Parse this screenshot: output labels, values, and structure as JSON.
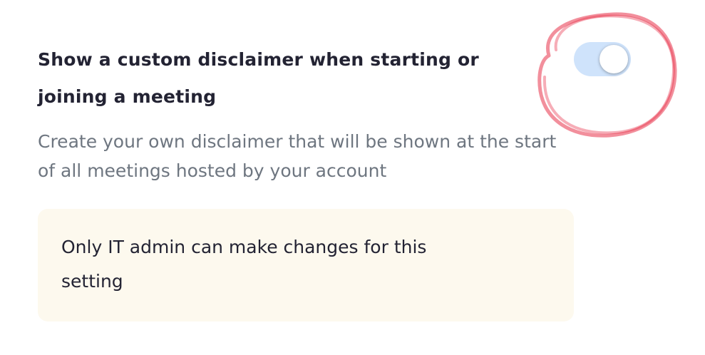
{
  "setting": {
    "title": "Show a custom disclaimer when starting or joining a meeting",
    "description": "Create your own disclaimer that will be shown at the start of all meetings hosted by your account",
    "toggle": {
      "state": "on",
      "disabled": true,
      "track_color": "#cfe3fb"
    }
  },
  "notice": {
    "text": "Only IT admin can make changes for this setting",
    "background_color": "#fdf9ee"
  },
  "annotation": {
    "shape": "circle",
    "color": "#e8334a"
  }
}
